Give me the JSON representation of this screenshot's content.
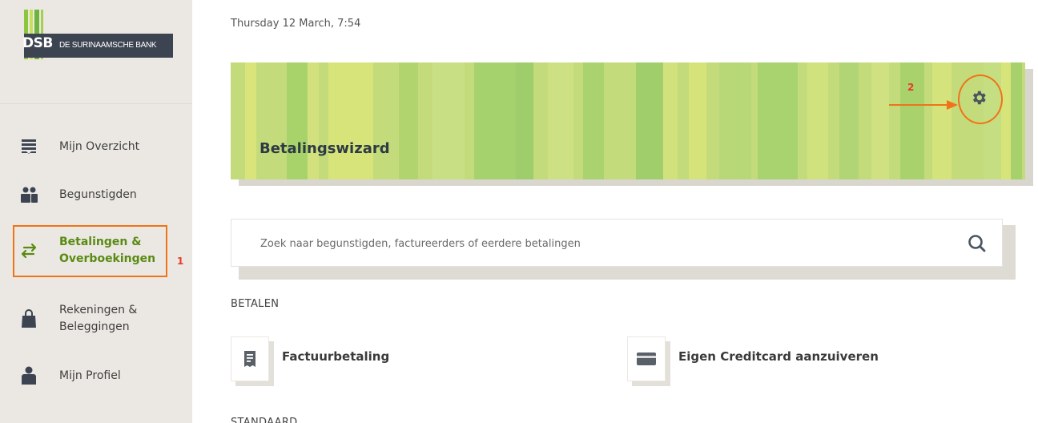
{
  "logo": {
    "abbr": "DSB",
    "name": "DE SURINAAMSCHE BANK"
  },
  "sidebar": {
    "items": [
      {
        "label": "Mijn Overzicht",
        "icon": "overview-icon",
        "active": false
      },
      {
        "label": "Begunstigden",
        "icon": "people-icon",
        "active": false
      },
      {
        "label": "Betalingen &\nOverboekingen",
        "icon": "transfer-arrows-icon",
        "active": true
      },
      {
        "label": "Rekeningen &\nBeleggingen",
        "icon": "bag-icon",
        "active": false
      },
      {
        "label": "Mijn Profiel",
        "icon": "person-icon",
        "active": false
      }
    ]
  },
  "annotations": {
    "marker_1": "1",
    "marker_2": "2"
  },
  "header": {
    "datetime": "Thursday 12 March, 7:54"
  },
  "banner": {
    "title": "Betalingswizard",
    "settings_icon": "gear-icon"
  },
  "search": {
    "placeholder": "Zoek naar begunstigden, factureerders of eerdere betalingen",
    "value": ""
  },
  "sections": {
    "betalen_label": "BETALEN",
    "next_label": "STANDAARD"
  },
  "tiles": [
    {
      "label": "Factuurbetaling",
      "icon": "receipt-icon"
    },
    {
      "label": "Eigen Creditcard aanzuiveren",
      "icon": "credit-card-icon"
    }
  ],
  "colors": {
    "accent_green": "#5a8a12",
    "annotation_orange": "#f07318",
    "annotation_red": "#e53b2c",
    "banner_green": "#c4db7b"
  }
}
